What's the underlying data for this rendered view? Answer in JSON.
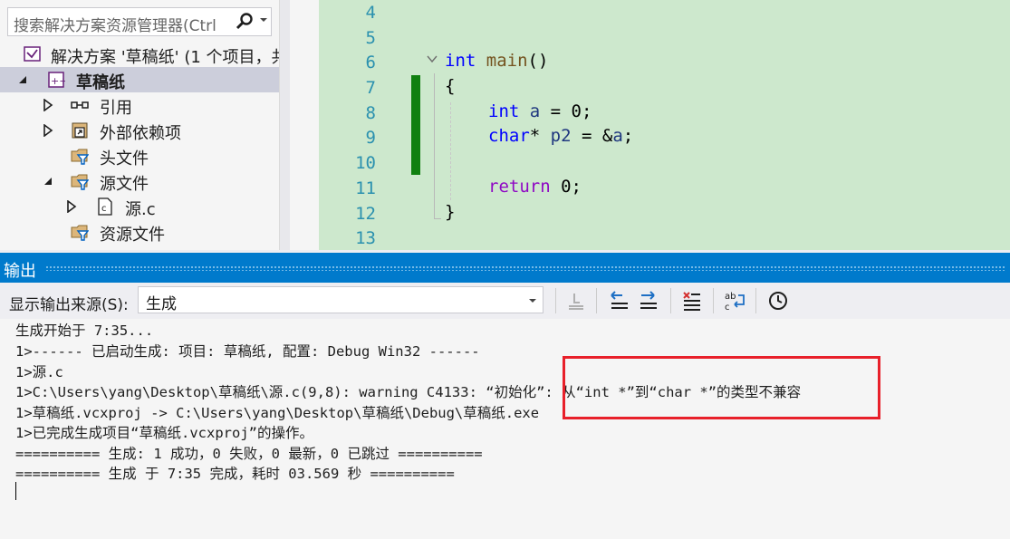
{
  "solution_explorer": {
    "search_placeholder": "搜索解决方案资源管理器(Ctrl",
    "items": [
      {
        "label": "解决方案 '草稿纸' (1 个项目，共",
        "icon": "solution-icon"
      },
      {
        "label": "草稿纸",
        "icon": "project-icon",
        "selected": true
      },
      {
        "label": "引用",
        "icon": "references-icon"
      },
      {
        "label": "外部依赖项",
        "icon": "external-deps-icon"
      },
      {
        "label": "头文件",
        "icon": "filter-folder-icon"
      },
      {
        "label": "源文件",
        "icon": "filter-folder-icon"
      },
      {
        "label": "源.c",
        "icon": "c-file-icon"
      },
      {
        "label": "资源文件",
        "icon": "filter-folder-icon"
      }
    ]
  },
  "editor": {
    "line_numbers": [
      "4",
      "5",
      "6",
      "7",
      "8",
      "9",
      "10",
      "11",
      "12",
      "13"
    ],
    "code": {
      "l6_kw": "int",
      "l6_fn": "main",
      "l6_rest": "()",
      "l7": "{",
      "l8_kw": "int",
      "l8_var": "a",
      "l8_rest": " = 0;",
      "l9_kw": "char",
      "l9_star": "*",
      "l9_var": "p2",
      "l9_mid": " = &",
      "l9_var2": "a",
      "l9_end": ";",
      "l11_kw": "return",
      "l11_rest": " 0;",
      "l12": "}"
    }
  },
  "output": {
    "title": "输出",
    "source_label": "显示输出来源(S):",
    "source_value": "生成",
    "lines": [
      "生成开始于 7:35...",
      "1>------ 已启动生成: 项目: 草稿纸, 配置: Debug Win32 ------",
      "1>源.c",
      "1>C:\\Users\\yang\\Desktop\\草稿纸\\源.c(9,8): warning C4133: “初始化”: 从“int *”到“char *”的类型不兼容",
      "1>草稿纸.vcxproj -> C:\\Users\\yang\\Desktop\\草稿纸\\Debug\\草稿纸.exe",
      "1>已完成生成项目“草稿纸.vcxproj”的操作。",
      "========== 生成: 1 成功，0 失败，0 最新，0 已跳过 ==========",
      "========== 生成 于 7:35 完成，耗时 03.569 秒 =========="
    ]
  },
  "colors": {
    "accent": "#007acc",
    "highlight_box": "#e8202a",
    "change_bar": "#108010",
    "editor_highlight": "#cde8cd"
  }
}
